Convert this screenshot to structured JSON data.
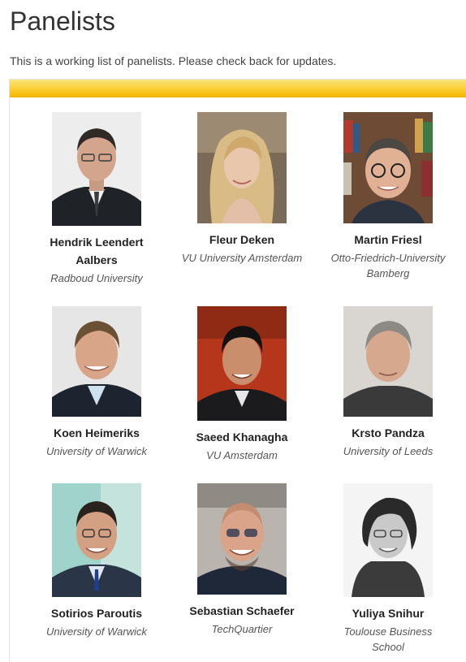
{
  "page": {
    "title": "Panelists",
    "intro": "This is a working list of panelists. Please check back for updates."
  },
  "panelists": [
    {
      "name": "Hendrik Leendert Aalbers",
      "affiliation": "Radboud University",
      "photo": "photo-of-hendrik-leendert-aalbers"
    },
    {
      "name": "Fleur Deken",
      "affiliation": "VU University Amsterdam",
      "photo": "photo-of-fleur-deken"
    },
    {
      "name": "Martin Friesl",
      "affiliation": "Otto-Friedrich-University Bamberg",
      "photo": "photo-of-martin-friesl"
    },
    {
      "name": "Koen Heimeriks",
      "affiliation": "University of Warwick",
      "photo": "photo-of-koen-heimeriks"
    },
    {
      "name": "Saeed Khanagha",
      "affiliation": "VU Amsterdam",
      "photo": "photo-of-saeed-khanagha"
    },
    {
      "name": "Krsto Pandza",
      "affiliation": "University of Leeds",
      "photo": "photo-of-krsto-pandza"
    },
    {
      "name": "Sotirios Paroutis",
      "affiliation": "University of Warwick",
      "photo": "photo-of-sotirios-paroutis"
    },
    {
      "name": "Sebastian Schaefer",
      "affiliation": "TechQuartier",
      "photo": "photo-of-sebastian-schaefer"
    },
    {
      "name": "Yuliya Snihur",
      "affiliation": "Toulouse Business School",
      "photo": "photo-of-yuliya-snihur"
    }
  ],
  "colors": {
    "header_band_top": "#fde47a",
    "header_band_bottom": "#f6b800"
  }
}
